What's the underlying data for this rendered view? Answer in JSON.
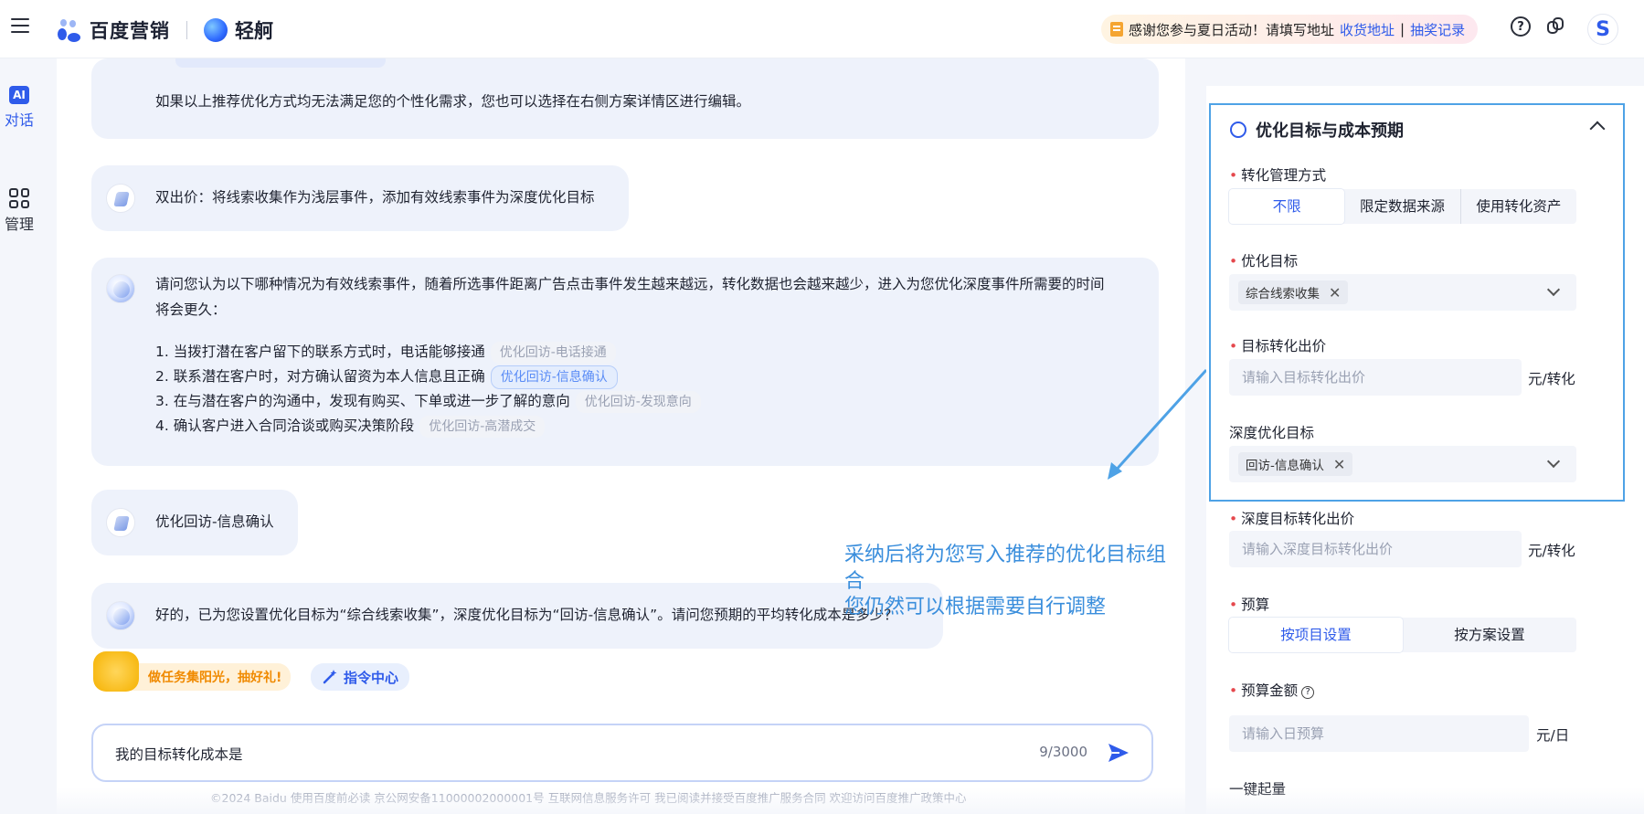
{
  "topbar": {
    "brand_name": "百度营销",
    "product_name": "轻舸",
    "notice_text": "感谢您参与夏日活动！请填写地址",
    "notice_link_address": "收货地址",
    "notice_divider": "|",
    "notice_link_lottery": "抽奖记录",
    "help_icon_glyph": "?",
    "avatar_letter": "S"
  },
  "leftnav": {
    "dialog_icon_text": "AI",
    "dialog_label": "对话",
    "manage_label": "管理"
  },
  "chat": {
    "msg_custom_edit": "如果以上推荐优化方式均无法满足您的个性化需求，您也可以选择在右侧方案详情区进行编辑。",
    "msg_dual_bid": "双出价：将线索收集作为浅层事件，添加有效线索事件为深度优化目标",
    "msg_question_line1": "请问您认为以下哪种情况为有效线索事件，随着所选事件距离广告点击事件发生越来越远，转化数据也会越来越少，进入为您优化深度事件所需要的时间",
    "msg_question_line2": "将会更久：",
    "options": [
      {
        "text": "1. 当拨打潜在客户留下的联系方式时，电话能够接通",
        "tag": "优化回访-电话接通",
        "active": false
      },
      {
        "text": "2. 联系潜在客户时，对方确认留资为本人信息且正确",
        "tag": "优化回访-信息确认",
        "active": true
      },
      {
        "text": "3. 在与潜在客户的沟通中，发现有购买、下单或进一步了解的意向",
        "tag": "优化回访-发现意向",
        "active": false
      },
      {
        "text": "4. 确认客户进入合同洽谈或购买决策阶段",
        "tag": "优化回访-高潜成交",
        "active": false
      }
    ],
    "msg_user_choice": "优化回访-信息确认",
    "msg_confirm": "好的，已为您设置优化目标为“综合线索收集”，深度优化目标为“回访-信息确认”。请问您预期的平均转化成本是多少？",
    "annotation_line1": "采纳后将为您写入推荐的优化目标组合",
    "annotation_line2": "您仍然可以根据需要自行调整",
    "task_chip_label": "做任务集阳光，抽好礼!",
    "command_chip_label": "指令中心",
    "input_value": "我的目标转化成本是",
    "input_counter": "9/3000"
  },
  "footer_text": "©2024 Baidu 使用百度前必读 京公网安备11000002000001号 互联网信息服务许可 我已阅读并接受百度推广服务合同 欢迎访问百度推广政策中心",
  "panel": {
    "section_title": "优化目标与成本预期",
    "conversion_mgmt_label": "转化管理方式",
    "conversion_mgmt_options": [
      "不限",
      "限定数据来源",
      "使用转化资产"
    ],
    "opt_goal_label": "优化目标",
    "opt_goal_chip": "综合线索收集",
    "target_bid_label": "目标转化出价",
    "target_bid_placeholder": "请输入目标转化出价",
    "target_bid_unit": "元/转化",
    "deep_goal_label": "深度优化目标",
    "deep_goal_chip": "回访-信息确认",
    "deep_bid_label": "深度目标转化出价",
    "deep_bid_placeholder": "请输入深度目标转化出价",
    "deep_bid_unit": "元/转化",
    "budget_label": "预算",
    "budget_options": [
      "按项目设置",
      "按方案设置"
    ],
    "budget_amount_label": "预算金额",
    "budget_amount_placeholder": "请输入日预算",
    "budget_amount_unit": "元/日",
    "one_click_label": "一键起量"
  },
  "colors": {
    "accent": "#2f5bea",
    "annotation": "#3a8edc",
    "required": "#e5484d"
  }
}
